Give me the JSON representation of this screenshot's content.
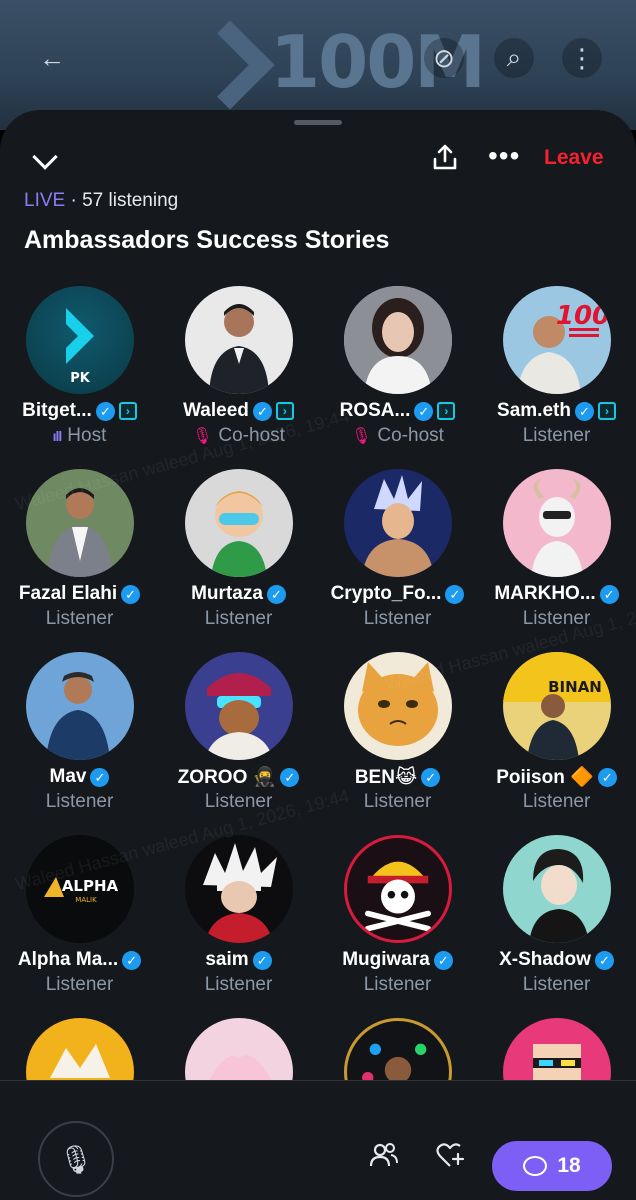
{
  "header": {
    "back_icon": "arrow-left-icon",
    "banner_text": "100M"
  },
  "top_bar": {
    "collapse_icon": "chevron-down-icon",
    "share_icon": "share-icon",
    "more_label": "•••",
    "leave_label": "Leave"
  },
  "status": {
    "live": "LIVE",
    "separator": " · ",
    "listening": "57 listening"
  },
  "space": {
    "title": "Ambassadors Success Stories"
  },
  "participants": [
    {
      "name": "Bitget...",
      "role": "Host",
      "verified": true,
      "brand": true,
      "role_icon": "bars"
    },
    {
      "name": "Waleed",
      "role": "Co-host",
      "verified": true,
      "brand": true,
      "role_icon": "mic-off"
    },
    {
      "name": "ROSA...",
      "role": "Co-host",
      "verified": true,
      "brand": true,
      "role_icon": "mic-off"
    },
    {
      "name": "Sam.eth",
      "role": "Listener",
      "verified": true,
      "brand": true,
      "role_icon": ""
    },
    {
      "name": "Fazal Elahi",
      "role": "Listener",
      "verified": true,
      "brand": false,
      "role_icon": ""
    },
    {
      "name": "Murtaza",
      "role": "Listener",
      "verified": true,
      "brand": false,
      "role_icon": ""
    },
    {
      "name": "Crypto_Fo...",
      "role": "Listener",
      "verified": true,
      "brand": false,
      "role_icon": ""
    },
    {
      "name": "MARKHO...",
      "role": "Listener",
      "verified": true,
      "brand": false,
      "role_icon": ""
    },
    {
      "name": "Mav",
      "role": "Listener",
      "verified": true,
      "brand": false,
      "role_icon": ""
    },
    {
      "name": "ZOROO 🥷",
      "role": "Listener",
      "verified": true,
      "brand": false,
      "role_icon": ""
    },
    {
      "name": "BEN😹",
      "role": "Listener",
      "verified": true,
      "brand": false,
      "role_icon": ""
    },
    {
      "name": "Poiison 🔶",
      "role": "Listener",
      "verified": true,
      "brand": false,
      "role_icon": ""
    },
    {
      "name": "Alpha Ma...",
      "role": "Listener",
      "verified": true,
      "brand": false,
      "role_icon": ""
    },
    {
      "name": "saim",
      "role": "Listener",
      "verified": true,
      "brand": false,
      "role_icon": ""
    },
    {
      "name": "Mugiwara",
      "role": "Listener",
      "verified": true,
      "brand": false,
      "role_icon": ""
    },
    {
      "name": "X-Shadow",
      "role": "Listener",
      "verified": true,
      "brand": false,
      "role_icon": ""
    }
  ],
  "avatar_text": {
    "bitget": "PK",
    "sam": "100",
    "alpha": "ALPHA",
    "alpha_sub": "MALIK",
    "poiison": "BINAN"
  },
  "bottom_bar": {
    "mic_icon": "microphone-icon",
    "people_icon": "people-icon",
    "react_icon": "heart-plus-icon",
    "comment_count": "18"
  },
  "watermark": "Waleed Hassan waleed Aug 1, 2026, 19:44",
  "colors": {
    "accent": "#7d5ff5",
    "live": "#8b7cf6",
    "leave": "#f4212e",
    "verified": "#1d9bf0",
    "mic_off": "#f91880"
  }
}
